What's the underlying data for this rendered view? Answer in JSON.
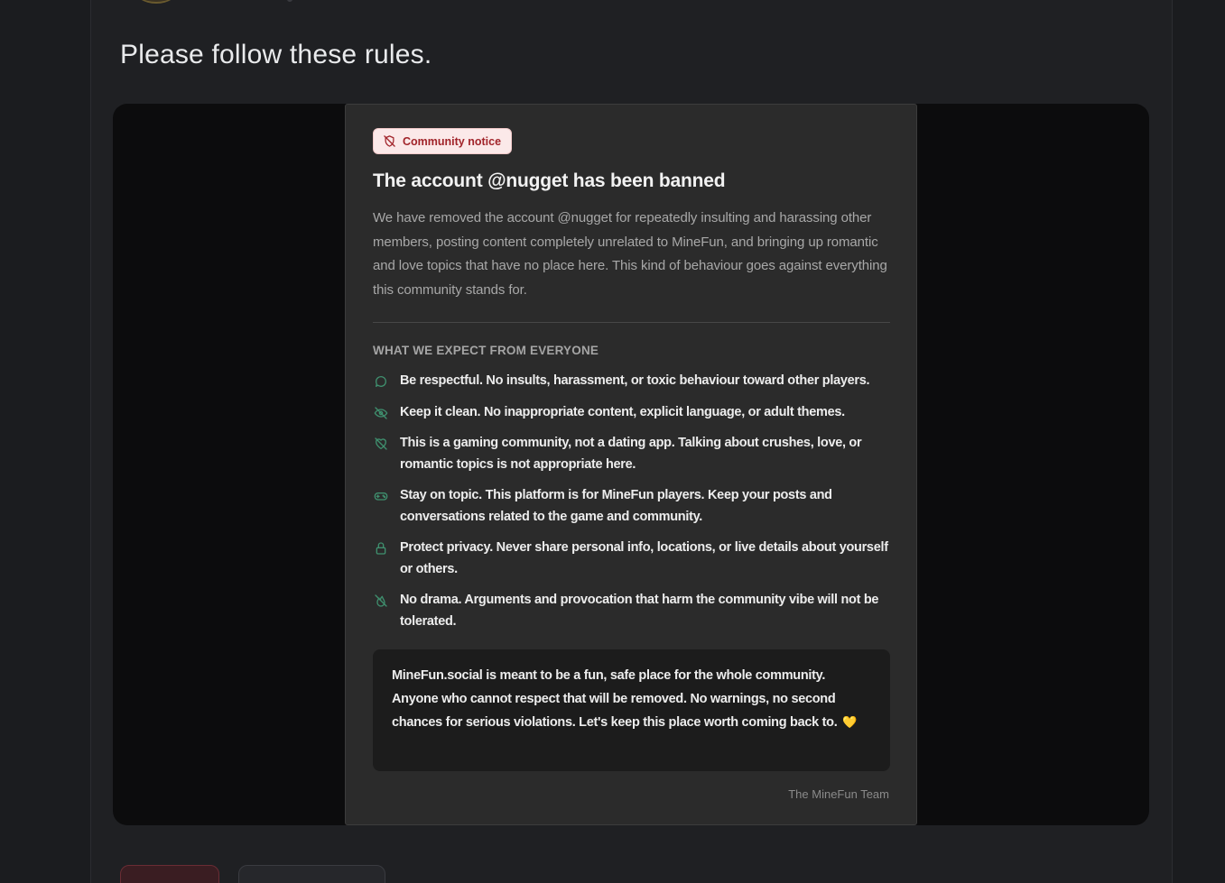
{
  "post": {
    "text": "Please follow these rules."
  },
  "notice": {
    "badge": {
      "label": "Community notice",
      "icon": "shield-off-icon"
    },
    "title": "The account @nugget has been banned",
    "intro": "We have removed the account @nugget for repeatedly insulting and harassing other members, posting content completely unrelated to MineFun, and bringing up romantic and love topics that have no place here. This kind of behaviour goes against everything this community stands for.",
    "section_heading": "WHAT WE EXPECT FROM EVERYONE",
    "rules": [
      {
        "icon": "chat-bubble-icon",
        "text": "Be respectful. No insults, harassment, or toxic behaviour toward other players."
      },
      {
        "icon": "eye-off-icon",
        "text": "Keep it clean. No inappropriate content, explicit language, or adult themes."
      },
      {
        "icon": "heart-off-icon",
        "text": "This is a gaming community, not a dating app. Talking about crushes, love, or romantic topics is not appropriate here."
      },
      {
        "icon": "gamepad-icon",
        "text": "Stay on topic. This platform is for MineFun players. Keep your posts and conversations related to the game and community."
      },
      {
        "icon": "lock-icon",
        "text": "Protect privacy. Never share personal info, locations, or live details about yourself or others."
      },
      {
        "icon": "flame-off-icon",
        "text": "No drama. Arguments and provocation that harm the community vibe will not be tolerated."
      }
    ],
    "callout": "MineFun.social is meant to be a fun, safe place for the whole community. Anyone who cannot respect that will be removed. No warnings, no second chances for serious violations. Let's keep this place worth coming back to.",
    "callout_emoji": "💛",
    "signature": "The MineFun Team"
  },
  "colors": {
    "page_bg": "#1b1c1f",
    "card_bg": "#2b2b2b",
    "badge_bg": "#fbe9e9",
    "badge_text": "#a1242a",
    "rule_icon": "#3f8f6e",
    "accent_heart": "#e7c04a"
  }
}
